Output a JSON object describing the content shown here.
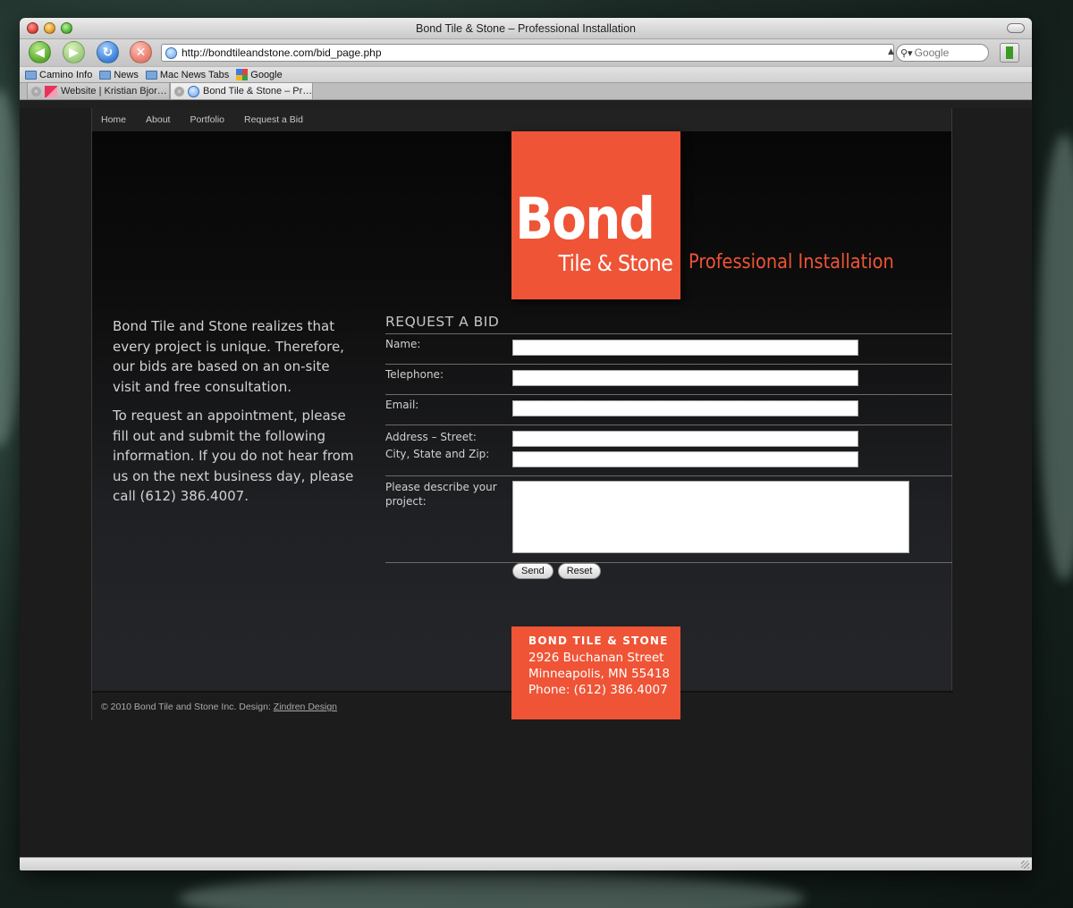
{
  "window": {
    "title": "Bond Tile & Stone – Professional Installation"
  },
  "toolbar": {
    "url": "http://bondtileandstone.com/bid_page.php",
    "search_placeholder": "Google"
  },
  "bookmarks": [
    "Camino Info",
    "News",
    "Mac News Tabs",
    "Google"
  ],
  "tabs": [
    {
      "label": "Website | Kristian Bjor…"
    },
    {
      "label": "Bond Tile & Stone – Pr…"
    }
  ],
  "site": {
    "nav": [
      "Home",
      "About",
      "Portfolio",
      "Request a Bid"
    ],
    "logo": {
      "main": "Bond",
      "sub": "Tile & Stone"
    },
    "tagline": "Professional Installation",
    "intro": [
      "Bond Tile and Stone realizes that every project is unique. Therefore, our bids are based on an on-site visit and free consultation.",
      "To request an appointment, please fill out and submit the following information. If you do not hear from us on the next business day, please call (612) 386.4007."
    ],
    "form": {
      "title": "REQUEST A BID",
      "name_label": "Name:",
      "telephone_label": "Telephone:",
      "email_label": "Email:",
      "street_label": "Address – Street:",
      "city_label": "City, State and Zip:",
      "project_label": "Please describe your project:",
      "send_label": "Send",
      "reset_label": "Reset"
    },
    "address": {
      "name": "BOND TILE & STONE",
      "street": "2926 Buchanan Street",
      "city": "Minneapolis, MN 55418",
      "phone": "Phone: (612) 386.4007"
    },
    "footer": {
      "copyright": "© 2010 Bond Tile and Stone Inc. Design:",
      "design_link": "Zindren Design"
    }
  },
  "colors": {
    "brand_orange": "#ef5436",
    "page_bg": "#1c1c1c"
  }
}
